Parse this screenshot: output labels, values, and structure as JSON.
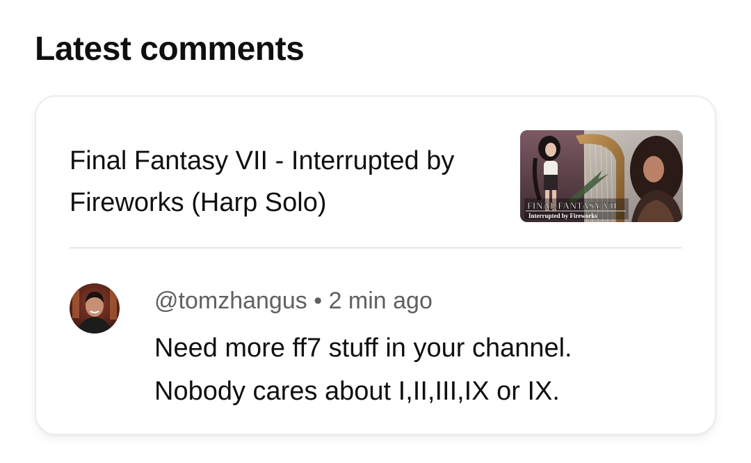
{
  "section": {
    "title": "Latest comments"
  },
  "comment_card": {
    "video": {
      "title": "Final Fantasy VII - Interrupted by Fireworks (Harp Solo)",
      "thumbnail": {
        "logo_text": "FINAL FANTASY VII",
        "subtitle_text": "Interrupted by Fireworks"
      }
    },
    "comment": {
      "author": "@tomzhangus",
      "separator": "•",
      "time": "2 min ago",
      "text": "Need more ff7 stuff in your channel. Nobody cares about I,II,III,IX or IX."
    }
  },
  "colors": {
    "text_primary": "#0f0f0f",
    "text_secondary": "#606060",
    "divider": "#e5e5e5",
    "card_border": "#ececec"
  }
}
